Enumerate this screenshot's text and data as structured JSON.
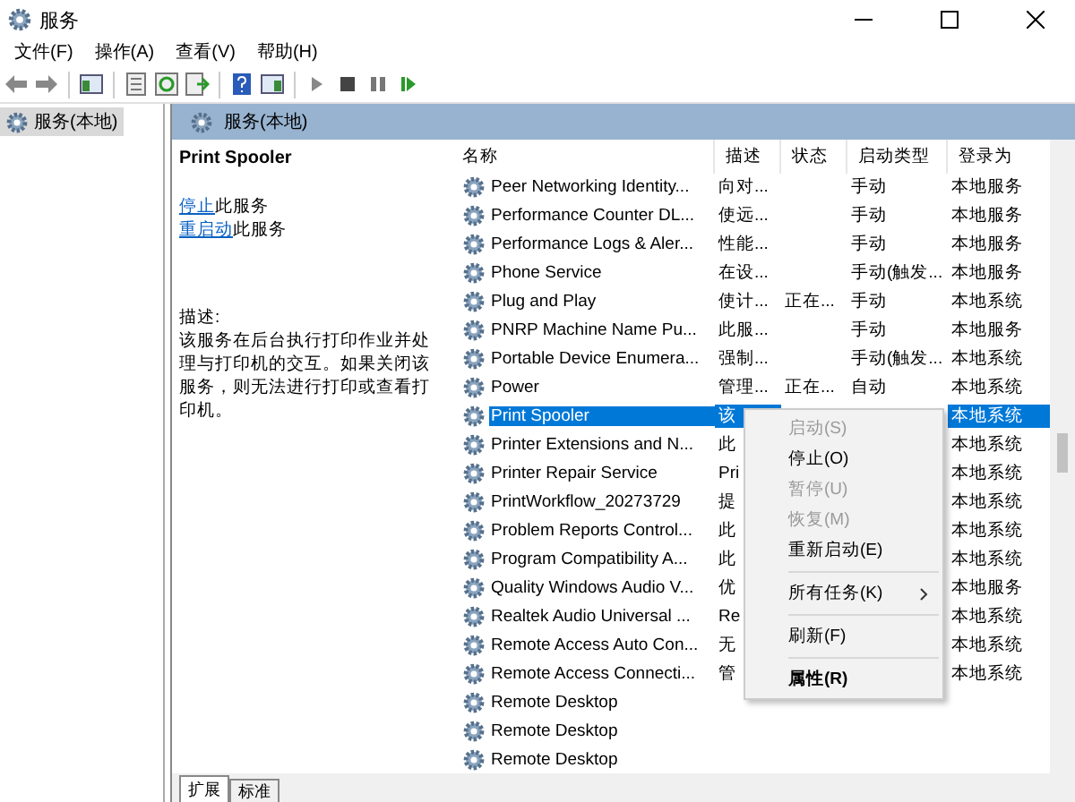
{
  "window": {
    "title": "服务"
  },
  "menu": [
    "文件(F)",
    "操作(A)",
    "查看(V)",
    "帮助(H)"
  ],
  "tree": {
    "label": "服务(本地)",
    "selected": true
  },
  "pane_header": "服务(本地)",
  "details": {
    "title": "Print Spooler",
    "links": [
      {
        "link": "停止",
        "rest": "此服务"
      },
      {
        "link": "重启动",
        "rest": "此服务"
      }
    ],
    "desc_label": "描述:",
    "description": "该服务在后台执行打印作业并处理与打印机的交互。如果关闭该服务，则无法进行打印或查看打印机。"
  },
  "table": {
    "columns": [
      "名称",
      "描述",
      "状态",
      "启动类型",
      "登录为"
    ],
    "rows": [
      {
        "name": "Peer Networking Identity...",
        "desc": "向对...",
        "status": "",
        "startup": "手动",
        "logon": "本地服务",
        "selected": false
      },
      {
        "name": "Performance Counter DL...",
        "desc": "使远...",
        "status": "",
        "startup": "手动",
        "logon": "本地服务",
        "selected": false
      },
      {
        "name": "Performance Logs & Aler...",
        "desc": "性能...",
        "status": "",
        "startup": "手动",
        "logon": "本地服务",
        "selected": false
      },
      {
        "name": "Phone Service",
        "desc": "在设...",
        "status": "",
        "startup": "手动(触发...",
        "logon": "本地服务",
        "selected": false
      },
      {
        "name": "Plug and Play",
        "desc": "使计...",
        "status": "正在...",
        "startup": "手动",
        "logon": "本地系统",
        "selected": false
      },
      {
        "name": "PNRP Machine Name Pu...",
        "desc": "此服...",
        "status": "",
        "startup": "手动",
        "logon": "本地服务",
        "selected": false
      },
      {
        "name": "Portable Device Enumera...",
        "desc": "强制...",
        "status": "",
        "startup": "手动(触发...",
        "logon": "本地系统",
        "selected": false
      },
      {
        "name": "Power",
        "desc": "管理...",
        "status": "正在...",
        "startup": "自动",
        "logon": "本地系统",
        "selected": false
      },
      {
        "name": "Print Spooler",
        "desc": "该",
        "status": "",
        "startup": "",
        "logon": "本地系统",
        "selected": true
      },
      {
        "name": "Printer Extensions and N...",
        "desc": "此",
        "status": "",
        "startup": "",
        "logon": "本地系统",
        "selected": false
      },
      {
        "name": "Printer Repair Service",
        "desc": "Pri",
        "status": "",
        "startup": "",
        "logon": "本地系统",
        "selected": false
      },
      {
        "name": "PrintWorkflow_20273729",
        "desc": "提",
        "status": "",
        "startup": "",
        "logon": "本地系统",
        "selected": false
      },
      {
        "name": "Problem Reports Control...",
        "desc": "此",
        "status": "",
        "startup": "",
        "logon": "本地系统",
        "selected": false
      },
      {
        "name": "Program Compatibility A...",
        "desc": "此",
        "status": "",
        "startup": "",
        "logon": "本地系统",
        "selected": false
      },
      {
        "name": "Quality Windows Audio V...",
        "desc": "优",
        "status": "",
        "startup": "",
        "logon": "本地服务",
        "selected": false
      },
      {
        "name": "Realtek Audio Universal ...",
        "desc": "Re",
        "status": "",
        "startup": "",
        "logon": "本地系统",
        "selected": false
      },
      {
        "name": "Remote Access Auto Con...",
        "desc": "无",
        "status": "",
        "startup": "",
        "logon": "本地系统",
        "selected": false
      },
      {
        "name": "Remote Access Connecti...",
        "desc": "管",
        "status": "",
        "startup": "",
        "logon": "本地系统",
        "selected": false
      },
      {
        "name": "Remote Desktop",
        "desc": "",
        "status": "",
        "startup": "",
        "logon": "",
        "selected": false
      },
      {
        "name": "Remote Desktop",
        "desc": "",
        "status": "",
        "startup": "",
        "logon": "",
        "selected": false
      },
      {
        "name": "Remote Desktop",
        "desc": "",
        "status": "",
        "startup": "",
        "logon": "",
        "selected": false
      }
    ]
  },
  "context_menu": [
    {
      "kind": "item",
      "label": "启动(S)",
      "disabled": true
    },
    {
      "kind": "item",
      "label": "停止(O)",
      "disabled": false
    },
    {
      "kind": "item",
      "label": "暂停(U)",
      "disabled": true
    },
    {
      "kind": "item",
      "label": "恢复(M)",
      "disabled": true
    },
    {
      "kind": "item",
      "label": "重新启动(E)",
      "disabled": false
    },
    {
      "kind": "separator"
    },
    {
      "kind": "submenu",
      "label": "所有任务(K)",
      "disabled": false
    },
    {
      "kind": "separator"
    },
    {
      "kind": "item",
      "label": "刷新(F)",
      "disabled": false
    },
    {
      "kind": "separator"
    },
    {
      "kind": "default",
      "label": "属性(R)",
      "disabled": false
    }
  ],
  "bottom_tabs": [
    {
      "label": "扩展",
      "selected": true
    },
    {
      "label": "标准",
      "selected": false
    }
  ]
}
